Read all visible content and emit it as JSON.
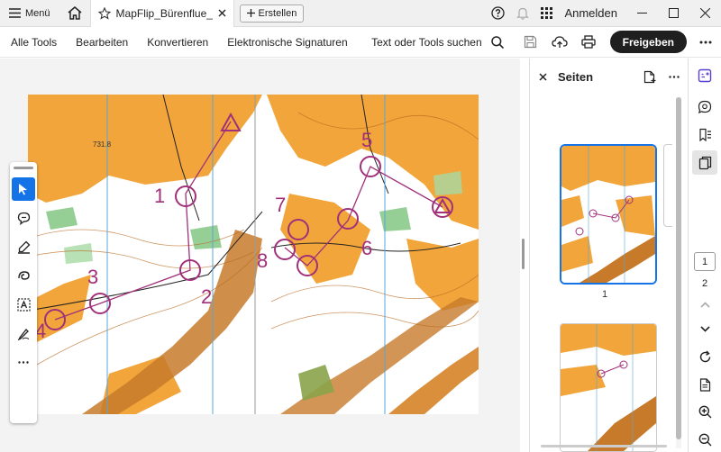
{
  "titlebar": {
    "menu_label": "Menü",
    "tab_title": "MapFlip_Bürenflue_...",
    "create_label": "Erstellen",
    "signin_label": "Anmelden"
  },
  "toolbar": {
    "items": [
      "Alle Tools",
      "Bearbeiten",
      "Konvertieren",
      "Elektronische Signaturen"
    ],
    "search_label": "Text oder Tools suchen",
    "share_label": "Freigeben"
  },
  "pages_panel": {
    "title": "Seiten",
    "page_labels": [
      "1"
    ]
  },
  "map": {
    "control_numbers": [
      "1",
      "2",
      "3",
      "4",
      "5",
      "6",
      "7",
      "8"
    ],
    "elevation_label": "731.8"
  },
  "page_nav": {
    "current": "1",
    "total": "2"
  },
  "colors": {
    "accent": "#1473e6",
    "course_magenta": "#a0307a",
    "map_orange": "#f2a53a",
    "map_brown": "#c77a2a"
  }
}
